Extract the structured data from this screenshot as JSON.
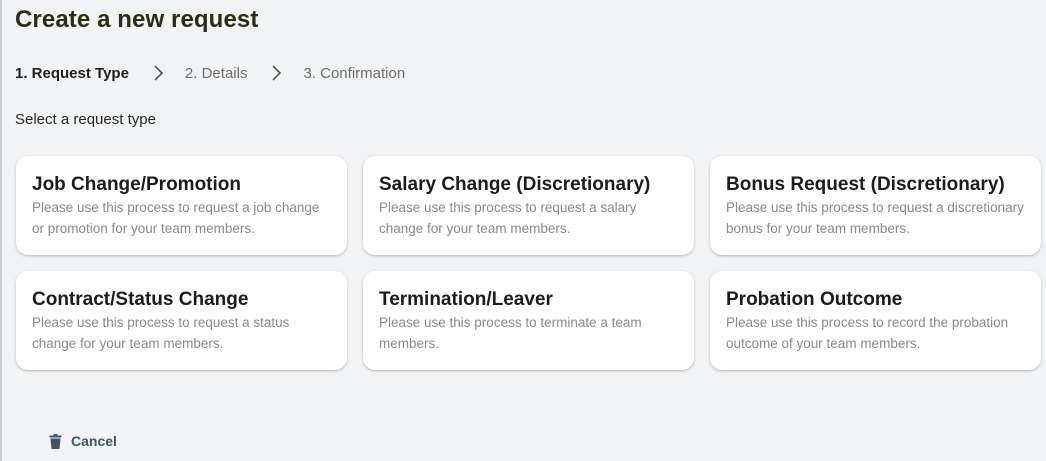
{
  "page": {
    "title": "Create a new request"
  },
  "stepper": {
    "steps": [
      {
        "label": "1. Request Type",
        "active": true
      },
      {
        "label": "2. Details",
        "active": false
      },
      {
        "label": "3. Confirmation",
        "active": false
      }
    ],
    "separator_icon": "chevron-right-icon"
  },
  "prompt": "Select a request type",
  "request_types": [
    {
      "title": "Job Change/Promotion",
      "description": "Please use this process to request a job change or promotion for your team members."
    },
    {
      "title": "Salary Change (Discretionary)",
      "description": "Please use this process to request a salary change for your team members."
    },
    {
      "title": "Bonus Request (Discretionary)",
      "description": "Please use this process to request a discretionary bonus for your team members."
    },
    {
      "title": "Contract/Status Change",
      "description": "Please use this process to request a status change for your team members."
    },
    {
      "title": "Termination/Leaver",
      "description": "Please use this process to terminate a team members."
    },
    {
      "title": "Probation Outcome",
      "description": "Please use this process to record the probation outcome of your team members."
    }
  ],
  "footer": {
    "cancel_label": "Cancel",
    "cancel_icon": "trash-icon"
  },
  "colors": {
    "background": "#f1f3f4",
    "title": "#2a2f0f",
    "cancel": "#3f5563"
  }
}
